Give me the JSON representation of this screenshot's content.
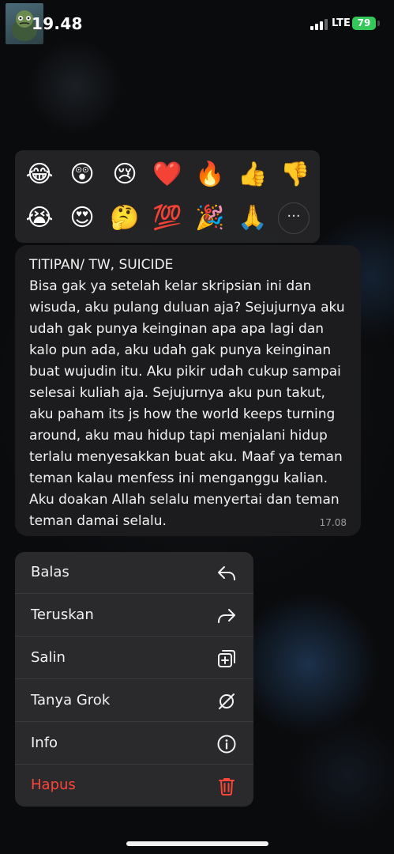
{
  "status_bar": {
    "time": "19.48",
    "network": "LTE",
    "battery": "79"
  },
  "reactions": {
    "emojis": [
      "😂",
      "😲",
      "😢",
      "❤️",
      "🔥",
      "👍",
      "👎",
      "😭",
      "😍",
      "🤔",
      "💯",
      "🎉",
      "🙏"
    ],
    "more_icon": "ellipsis-icon",
    "more_label": "···"
  },
  "message": {
    "title": "TITIPAN/ TW, SUICIDE",
    "body": "Bisa gak ya setelah kelar skripsian ini dan wisuda, aku pulang duluan aja? Sejujurnya aku udah gak punya keinginan apa apa lagi dan kalo pun ada, aku udah gak punya keinginan buat wujudin itu. Aku pikir udah cukup sampai selesai kuliah aja. Sejujurnya aku pun takut, aku paham its js how the world keeps turning around, aku mau hidup tapi menjalani hidup terlalu menyesakkan buat aku. Maaf ya teman teman kalau menfess ini menganggu kalian. Aku doakan Allah selalu menyertai dan teman teman damai selalu.",
    "time": "17.08"
  },
  "menu": {
    "items": [
      {
        "label": "Balas",
        "icon": "reply-icon"
      },
      {
        "label": "Teruskan",
        "icon": "forward-icon"
      },
      {
        "label": "Salin",
        "icon": "copy-icon"
      },
      {
        "label": "Tanya Grok",
        "icon": "grok-icon"
      },
      {
        "label": "Info",
        "icon": "info-icon"
      },
      {
        "label": "Hapus",
        "icon": "trash-icon"
      }
    ]
  },
  "colors": {
    "danger": "#ff453a",
    "battery": "#34c759",
    "bubble": "#1c1c1e",
    "menu": "#2a2a2c"
  }
}
